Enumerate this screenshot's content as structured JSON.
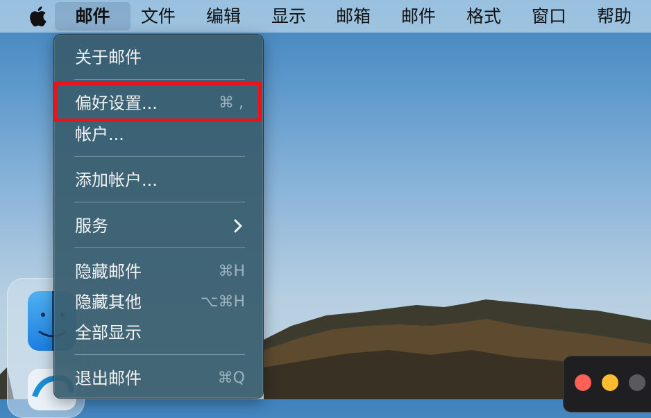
{
  "menubar": {
    "apple_icon": "apple-logo-icon",
    "items": [
      {
        "label": "邮件",
        "active": true
      },
      {
        "label": "文件"
      },
      {
        "label": "编辑"
      },
      {
        "label": "显示"
      },
      {
        "label": "邮箱"
      },
      {
        "label": "邮件"
      },
      {
        "label": "格式"
      },
      {
        "label": "窗口"
      },
      {
        "label": "帮助"
      }
    ]
  },
  "dropdown": {
    "items": [
      {
        "label": "关于邮件",
        "shortcut": ""
      },
      {
        "label": "偏好设置...",
        "shortcut": "⌘ ,"
      },
      {
        "label": "帐户...",
        "shortcut": ""
      },
      {
        "label": "添加帐户...",
        "shortcut": ""
      },
      {
        "label": "服务",
        "shortcut": ""
      },
      {
        "label": "隐藏邮件",
        "shortcut": "⌘H"
      },
      {
        "label": "隐藏其他",
        "shortcut": "⌥⌘H"
      },
      {
        "label": "全部显示",
        "shortcut": ""
      },
      {
        "label": "退出邮件",
        "shortcut": "⌘Q"
      }
    ]
  },
  "colors": {
    "highlight_border": "#e8141c",
    "close": "#fe5f57",
    "minimize": "#febc2e",
    "zoom": "#5a5a5e"
  }
}
